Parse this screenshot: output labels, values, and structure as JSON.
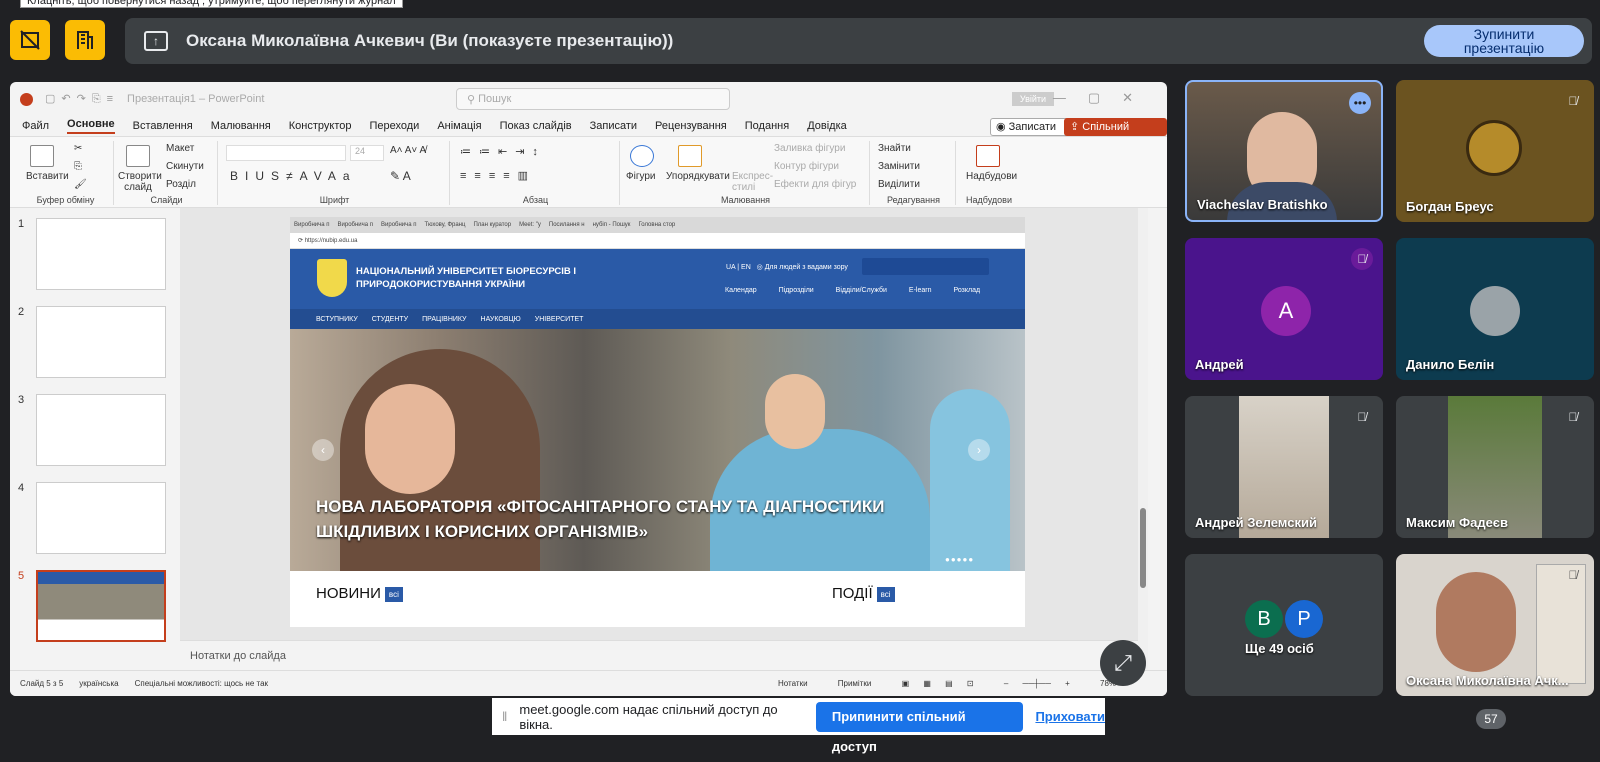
{
  "tooltip": "Клацніть, щоб повернутися назад ; утримуйте, щоб переглянути журнал",
  "meet": {
    "presenter_text": "Оксана Миколаївна Ачкевич (Ви (показуєте презентацію))",
    "stop_button": "Зупинити презентацію",
    "share_notice": "meet.google.com надає спільний доступ до вікна.",
    "stop_share_button": "Припинити спільний доступ",
    "hide_link": "Приховати",
    "participant_count": "57",
    "colors": {
      "accent": "#fbbc04",
      "stop": "#a8c7fa",
      "link": "#1a73e8"
    }
  },
  "ppt": {
    "title": "Презентація1 – PowerPoint",
    "search_placeholder": "Пошук",
    "signin": "Увійти",
    "menu": [
      "Файл",
      "Основне",
      "Вставлення",
      "Малювання",
      "Конструктор",
      "Переходи",
      "Анімація",
      "Показ слайдів",
      "Записати",
      "Рецензування",
      "Подання",
      "Довідка"
    ],
    "record_button": "Записати",
    "share_button": "Спільний доступ",
    "ribbon": {
      "clipboard_label": "Буфер обміну",
      "paste": "Вставити",
      "slides_label": "Слайди",
      "new_slide": "Створити слайд",
      "layout": "Макет",
      "reset": "Скинути",
      "sections": "Розділ",
      "font_label": "Шрифт",
      "font_size": "24",
      "paragraph_label": "Абзац",
      "drawing_label": "Малювання",
      "shapes": "Фігури",
      "arrange": "Упорядкувати",
      "quick_styles": "Експрес-стилі",
      "shape_fill": "Заливка фігури",
      "shape_outline": "Контур фігури",
      "shape_effects": "Ефекти для фігур",
      "editing_label": "Редагування",
      "find": "Знайти",
      "replace": "Замінити",
      "select": "Виділити",
      "addins_label": "Надбудови",
      "addins": "Надбудови"
    },
    "slide_numbers": [
      "1",
      "2",
      "3",
      "4",
      "5"
    ],
    "notes_placeholder": "Нотатки до слайда",
    "status": {
      "slide_of": "Слайд 5 з 5",
      "language": "українська",
      "accessibility": "Спеціальні можливості: щось не так",
      "notes": "Нотатки",
      "comments": "Примітки",
      "zoom": "78%"
    }
  },
  "slide_content": {
    "tabs": [
      "Виробнича п",
      "Виробнича п",
      "Виробнича п",
      "Тюхову, Франц",
      "План куратор",
      "Meet: \"у",
      "Посилання н",
      "нубіп - Пошук",
      "Головна стор"
    ],
    "url": "https://nubip.edu.ua",
    "university_line1": "НАЦІОНАЛЬНИЙ УНІВЕРСИТЕТ БІОРЕСУРСІВ І",
    "university_line2": "ПРИРОДОКОРИСТУВАННЯ УКРАЇНИ",
    "lang": "UA | EN",
    "accessibility": "Для людей з вадами зору",
    "links": [
      "Календар",
      "Підрозділи",
      "Відділи/Служби",
      "E-learn",
      "Розклад"
    ],
    "nav": [
      "ВСТУПНИКУ",
      "СТУДЕНТУ",
      "ПРАЦІВНИКУ",
      "НАУКОВЦЮ",
      "УНІВЕРСИТЕТ"
    ],
    "hero_line1": "НОВА ЛАБОРАТОРІЯ «ФІТОСАНІТАРНОГО СТАНУ ТА ДІАГНОСТИКИ",
    "hero_line2": "ШКІДЛИВИХ І КОРИСНИХ ОРГАНІЗМІВ»",
    "news": "НОВИНИ",
    "events": "ПОДІЇ",
    "all": "всі"
  },
  "participants": [
    {
      "name": "Viacheslav Bratishko"
    },
    {
      "name": "Богдан Бреус"
    },
    {
      "name": "Андрей",
      "initial": "А"
    },
    {
      "name": "Данило Белін"
    },
    {
      "name": "Андрей Зелемский"
    },
    {
      "name": "Максим Фадеєв"
    },
    {
      "name": "Ще 49 осіб",
      "initials": [
        "B",
        "P"
      ]
    },
    {
      "name": "Оксана Миколаївна Ачк..."
    }
  ]
}
